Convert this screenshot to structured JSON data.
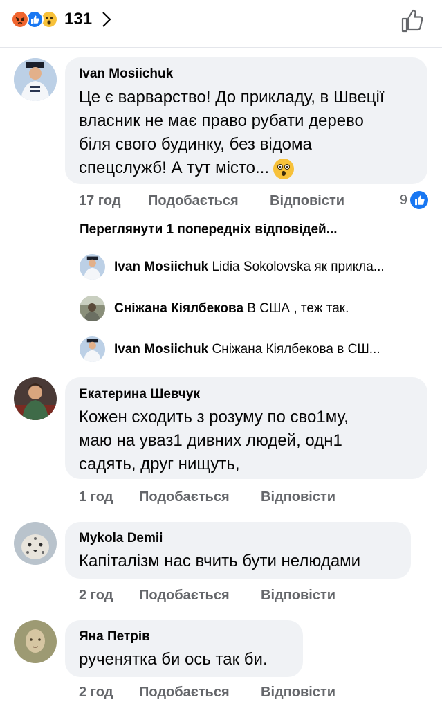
{
  "header": {
    "reaction_count": "131"
  },
  "comments": [
    {
      "author": "Ivan Mosiichuk",
      "lines": [
        "Це є варварство! До прикладу, в Швеції",
        "власник не має право рубати дерево",
        "біля свого будинку, без відома",
        "спецслужб! А тут місто..."
      ],
      "time": "17 год",
      "like": "Подобається",
      "reply": "Відповісти",
      "likes": "9",
      "view_previous": "Переглянути 1 попередніх відповідей...",
      "replies": [
        {
          "author": "Ivan Mosiichuk",
          "text": "Lidia Sokolovska як прикла..."
        },
        {
          "author": "Сніжана Кіялбекова",
          "text": "В США , теж так."
        },
        {
          "author": "Ivan Mosiichuk",
          "text": "Сніжана Кіялбекова в СШ..."
        }
      ]
    },
    {
      "author": "Екатерина Шевчук",
      "lines": [
        "Кожен сходить з розуму по сво1му,",
        "маю на уваз1 дивних людей, одн1",
        "садять, друг нищуть,"
      ],
      "time": "1 год",
      "like": "Подобається",
      "reply": "Відповісти"
    },
    {
      "author": "Mykola Demii",
      "lines": [
        "Капіталізм нас вчить бути нелюдами"
      ],
      "time": "2 год",
      "like": "Подобається",
      "reply": "Відповісти"
    },
    {
      "author": "Яна Петрів",
      "lines": [
        "рученятка би ось так би."
      ],
      "time": "2 год",
      "like": "Подобається",
      "reply": "Відповісти"
    }
  ]
}
